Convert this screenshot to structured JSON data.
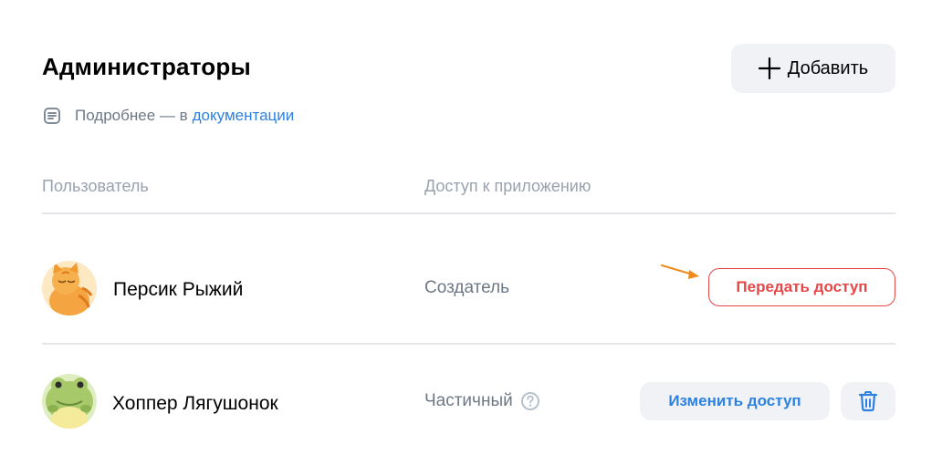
{
  "header": {
    "title": "Администраторы",
    "add_button_label": "Добавить"
  },
  "docs": {
    "prefix": "Подробнее — в",
    "link_text": "документации",
    "icon": "document-icon"
  },
  "table": {
    "columns": [
      "Пользователь",
      "Доступ к приложению"
    ],
    "rows": [
      {
        "name": "Персик Рыжий",
        "access": "Создатель",
        "action_label": "Передать доступ",
        "avatar": "orange-cat-avatar"
      },
      {
        "name": "Хоппер Лягушонок",
        "access": "Частичный",
        "action_label": "Изменить доступ",
        "avatar": "frog-avatar"
      }
    ]
  },
  "colors": {
    "accent_blue": "#2d81e0",
    "danger_red": "#e64646",
    "secondary_text": "#6d7885",
    "button_bg": "#f0f2f5",
    "annotation_arrow": "#f08a1c"
  }
}
